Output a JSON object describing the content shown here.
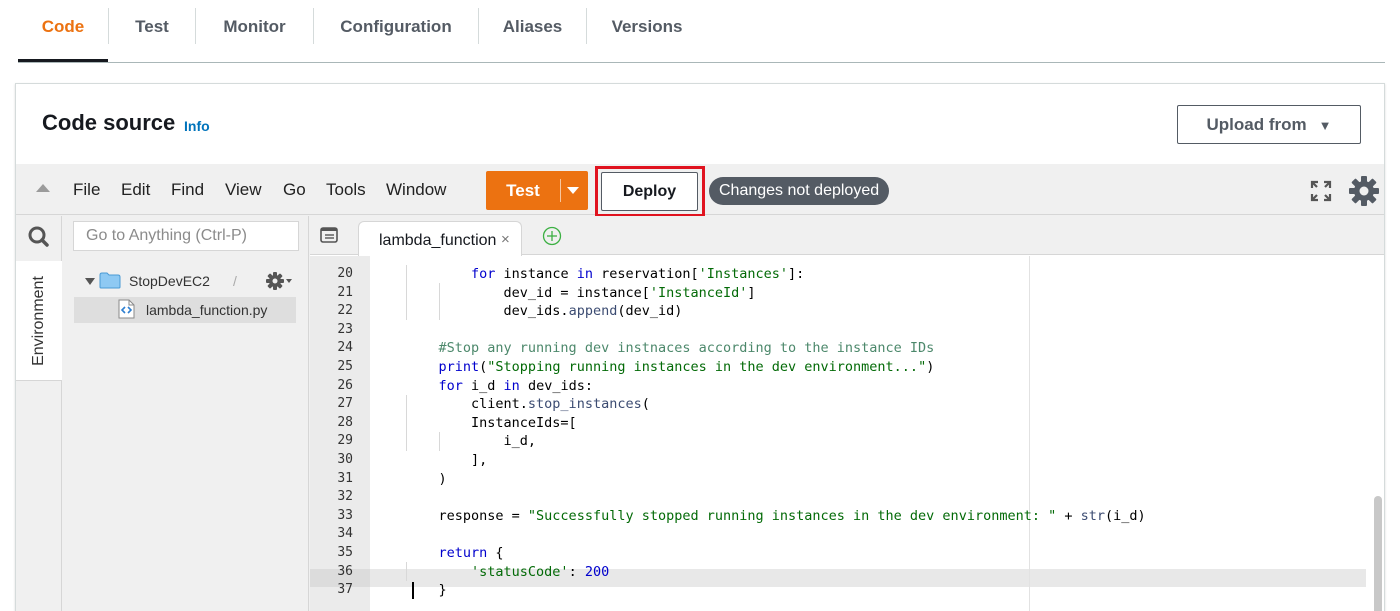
{
  "tabs": [
    {
      "label": "Code",
      "active": true
    },
    {
      "label": "Test"
    },
    {
      "label": "Monitor"
    },
    {
      "label": "Configuration"
    },
    {
      "label": "Aliases"
    },
    {
      "label": "Versions"
    }
  ],
  "panel": {
    "title": "Code source",
    "info_link": "Info",
    "upload_button": "Upload from"
  },
  "ide": {
    "menu": [
      "File",
      "Edit",
      "Find",
      "View",
      "Go",
      "Tools",
      "Window"
    ],
    "test_button": "Test",
    "deploy_button": "Deploy",
    "status_badge": "Changes not deployed",
    "search_placeholder": "Go to Anything (Ctrl-P)",
    "environment_tab": "Environment",
    "tree": {
      "folder": "StopDevEC2",
      "folder_suffix": "/",
      "file": "lambda_function.py"
    },
    "editor_tab": "lambda_function",
    "editor_tab_close": "×"
  },
  "code": {
    "line_numbers": [
      "20",
      "21",
      "22",
      "23",
      "24",
      "25",
      "26",
      "27",
      "28",
      "29",
      "30",
      "31",
      "32",
      "33",
      "34",
      "35",
      "36",
      "37"
    ],
    "active_line": "37"
  },
  "colors": {
    "accent": "#ec7211",
    "highlight_box": "#e0131f",
    "badge": "#545b64",
    "link": "#0073bb"
  }
}
